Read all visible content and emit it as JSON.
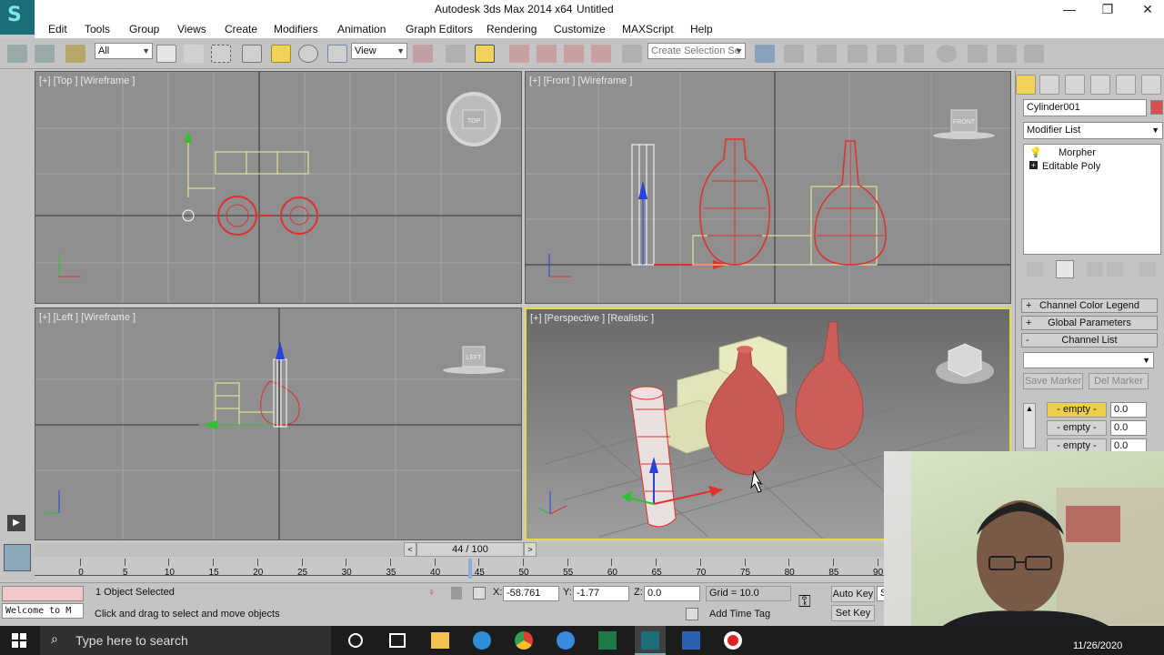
{
  "window": {
    "title": "Autodesk 3ds Max  2014 x64",
    "doc_title": "Untitled",
    "minimize": "—",
    "maximize": "❐",
    "close": "✕"
  },
  "menu": [
    "Edit",
    "Tools",
    "Group",
    "Views",
    "Create",
    "Modifiers",
    "Animation",
    "Graph Editors",
    "Rendering",
    "Customize",
    "MAXScript",
    "Help"
  ],
  "toolbar": {
    "selection_filter": "All",
    "ref_coord": "View",
    "named_selection_placeholder": "Create Selection Se"
  },
  "viewports": {
    "top": "[+] [Top ] [Wireframe ]",
    "front": "[+] [Front ] [Wireframe ]",
    "left": "[+] [Left ] [Wireframe ]",
    "perspective": "[+] [Perspective ] [Realistic ]",
    "cube_top": "TOP",
    "cube_front": "FRONT",
    "cube_left": "LEFT"
  },
  "command_panel": {
    "object_name": "Cylinder001",
    "object_color": "#d95050",
    "modifier_list": "Modifier List",
    "stack": [
      "Morpher",
      "Editable Poly"
    ],
    "rollouts": [
      {
        "sign": "+",
        "label": "Channel Color Legend"
      },
      {
        "sign": "+",
        "label": "Global Parameters"
      },
      {
        "sign": "-",
        "label": "Channel List"
      }
    ],
    "save_marker": "Save Marker",
    "del_marker": "Del Marker",
    "channels": [
      {
        "label": "- empty -",
        "value": "0.0"
      },
      {
        "label": "- empty -",
        "value": "0.0"
      },
      {
        "label": "- empty -",
        "value": "0.0"
      }
    ]
  },
  "timeline": {
    "frame_readout": "44 / 100",
    "current_frame": 44,
    "total_frames": 100,
    "ticks": [
      "0",
      "5",
      "10",
      "15",
      "20",
      "25",
      "30",
      "35",
      "40",
      "45",
      "50",
      "55",
      "60",
      "65",
      "70",
      "75",
      "80",
      "85",
      "90"
    ]
  },
  "status": {
    "selection": "1 Object Selected",
    "prompt": "Click and drag to select and move objects",
    "maxscript_listener": "Welcome to M",
    "x_label": "X:",
    "x": "-58.761",
    "y_label": "Y:",
    "y": "-1.77",
    "z_label": "Z:",
    "z": "0.0",
    "grid": "Grid = 10.0",
    "add_time_tag": "Add Time Tag",
    "auto_key": "Auto Key",
    "set_key": "Set Key",
    "partial": "S"
  },
  "taskbar": {
    "search_placeholder": "Type here to search",
    "date": "11/26/2020"
  }
}
